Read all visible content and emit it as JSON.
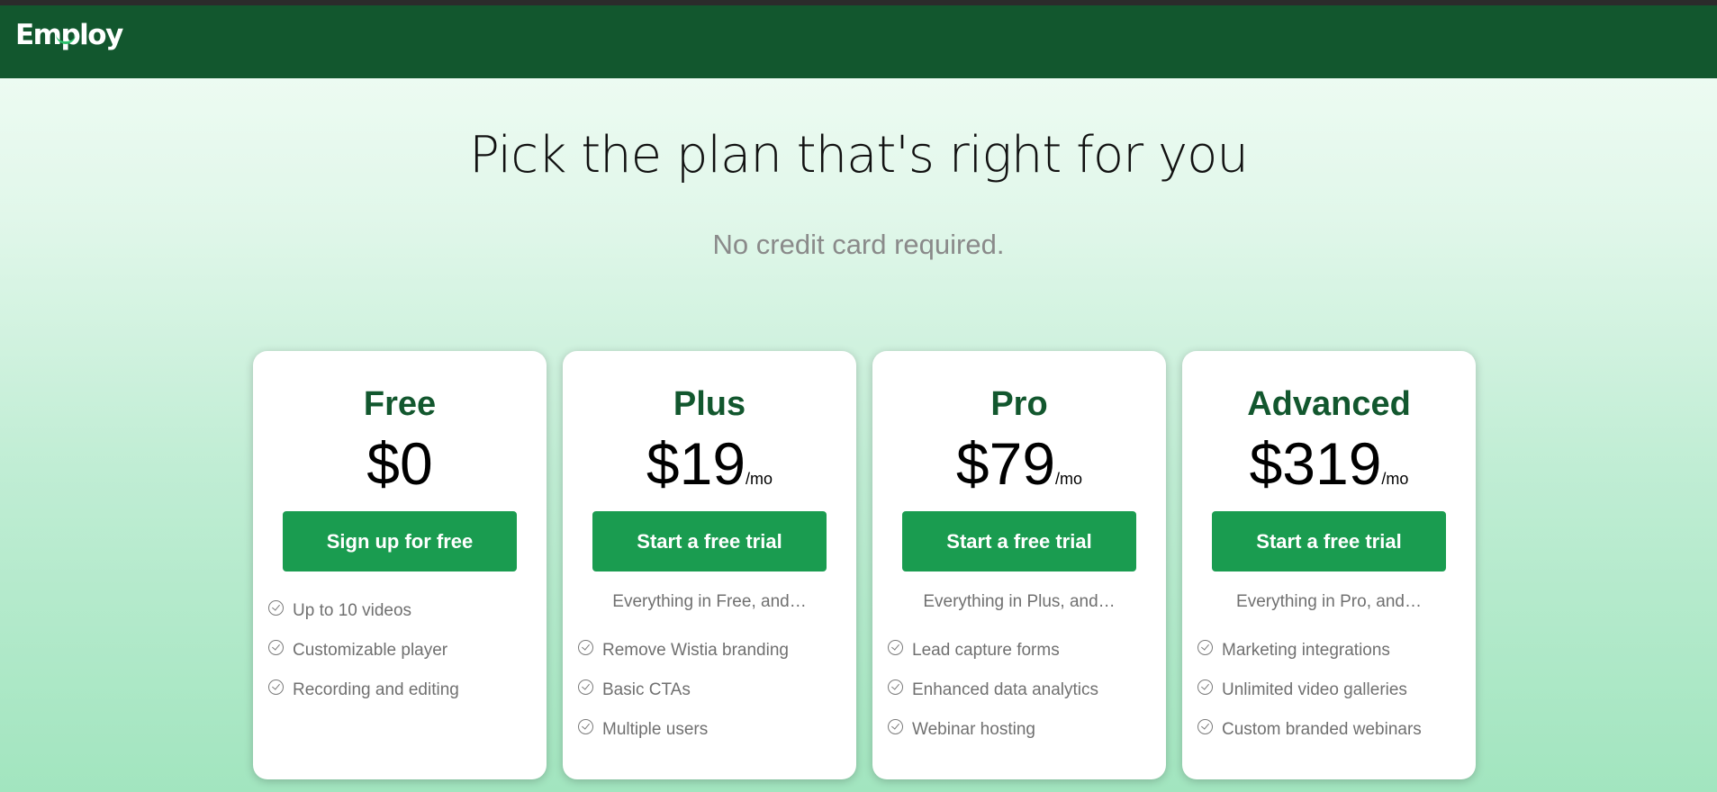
{
  "header": {
    "logo_text": "Employ",
    "brand_color": "#12572e",
    "accent_color": "#1a9c50"
  },
  "hero": {
    "title": "Pick the plan that's right for you",
    "subtitle": "No credit card required."
  },
  "plans": [
    {
      "name": "Free",
      "price": "$0",
      "period": "",
      "cta": "Sign up for free",
      "intro": "",
      "features": [
        "Up to 10 videos",
        "Customizable player",
        "Recording and editing"
      ]
    },
    {
      "name": "Plus",
      "price": "$19",
      "period": "/mo",
      "cta": "Start a free trial",
      "intro": "Everything in Free, and…",
      "features": [
        "Remove Wistia branding",
        "Basic CTAs",
        "Multiple users"
      ]
    },
    {
      "name": "Pro",
      "price": "$79",
      "period": "/mo",
      "cta": "Start a free trial",
      "intro": "Everything in Plus, and…",
      "features": [
        "Lead capture forms",
        "Enhanced data analytics",
        "Webinar hosting"
      ]
    },
    {
      "name": "Advanced",
      "price": "$319",
      "period": "/mo",
      "cta": "Start a free trial",
      "intro": "Everything in Pro, and…",
      "features": [
        "Marketing integrations",
        "Unlimited video galleries",
        "Custom branded webinars"
      ]
    }
  ]
}
